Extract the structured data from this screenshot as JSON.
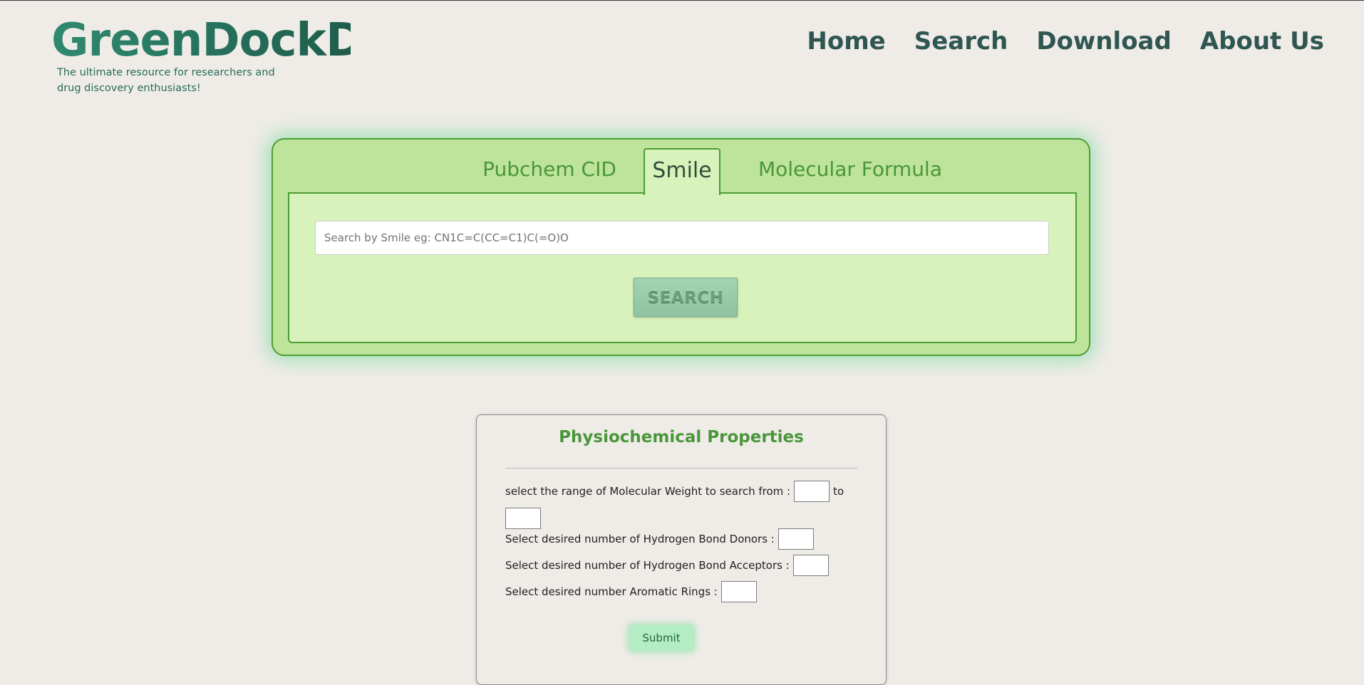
{
  "header": {
    "title": "GreenDockDB",
    "tagline": "The ultimate resource for researchers and drug discovery enthusiasts!",
    "nav": [
      {
        "label": "Home"
      },
      {
        "label": "Search"
      },
      {
        "label": "Download"
      },
      {
        "label": "About Us"
      }
    ]
  },
  "search": {
    "tabs": [
      {
        "label": "Pubchem CID",
        "active": false
      },
      {
        "label": "Smile",
        "active": true
      },
      {
        "label": "Molecular Formula",
        "active": false
      }
    ],
    "placeholder": "Search by Smile eg: CN1C=C(CC=C1)C(=O)O",
    "value": "",
    "button_label": "SEARCH"
  },
  "properties": {
    "title": "Physiochemical Properties",
    "mw_label": "select the range of Molecular Weight to search from :",
    "mw_to_label": "to",
    "mw_from_value": "",
    "mw_to_value": "",
    "hbd_label": "Select desired number of Hydrogen Bond Donors :",
    "hbd_value": "",
    "hba_label": "Select desired number of Hydrogen Bond Acceptors :",
    "hba_value": "",
    "aromatic_label": "Select desired number Aromatic Rings :",
    "aromatic_value": "",
    "submit_label": "Submit"
  },
  "colors": {
    "background": "#efece8",
    "brand": "#276b58",
    "nav": "#2f5651",
    "panel": "#bee49b",
    "panel_inner": "#d8f2bc",
    "accent_green": "#4a963a",
    "submit": "#b4ecc4"
  }
}
